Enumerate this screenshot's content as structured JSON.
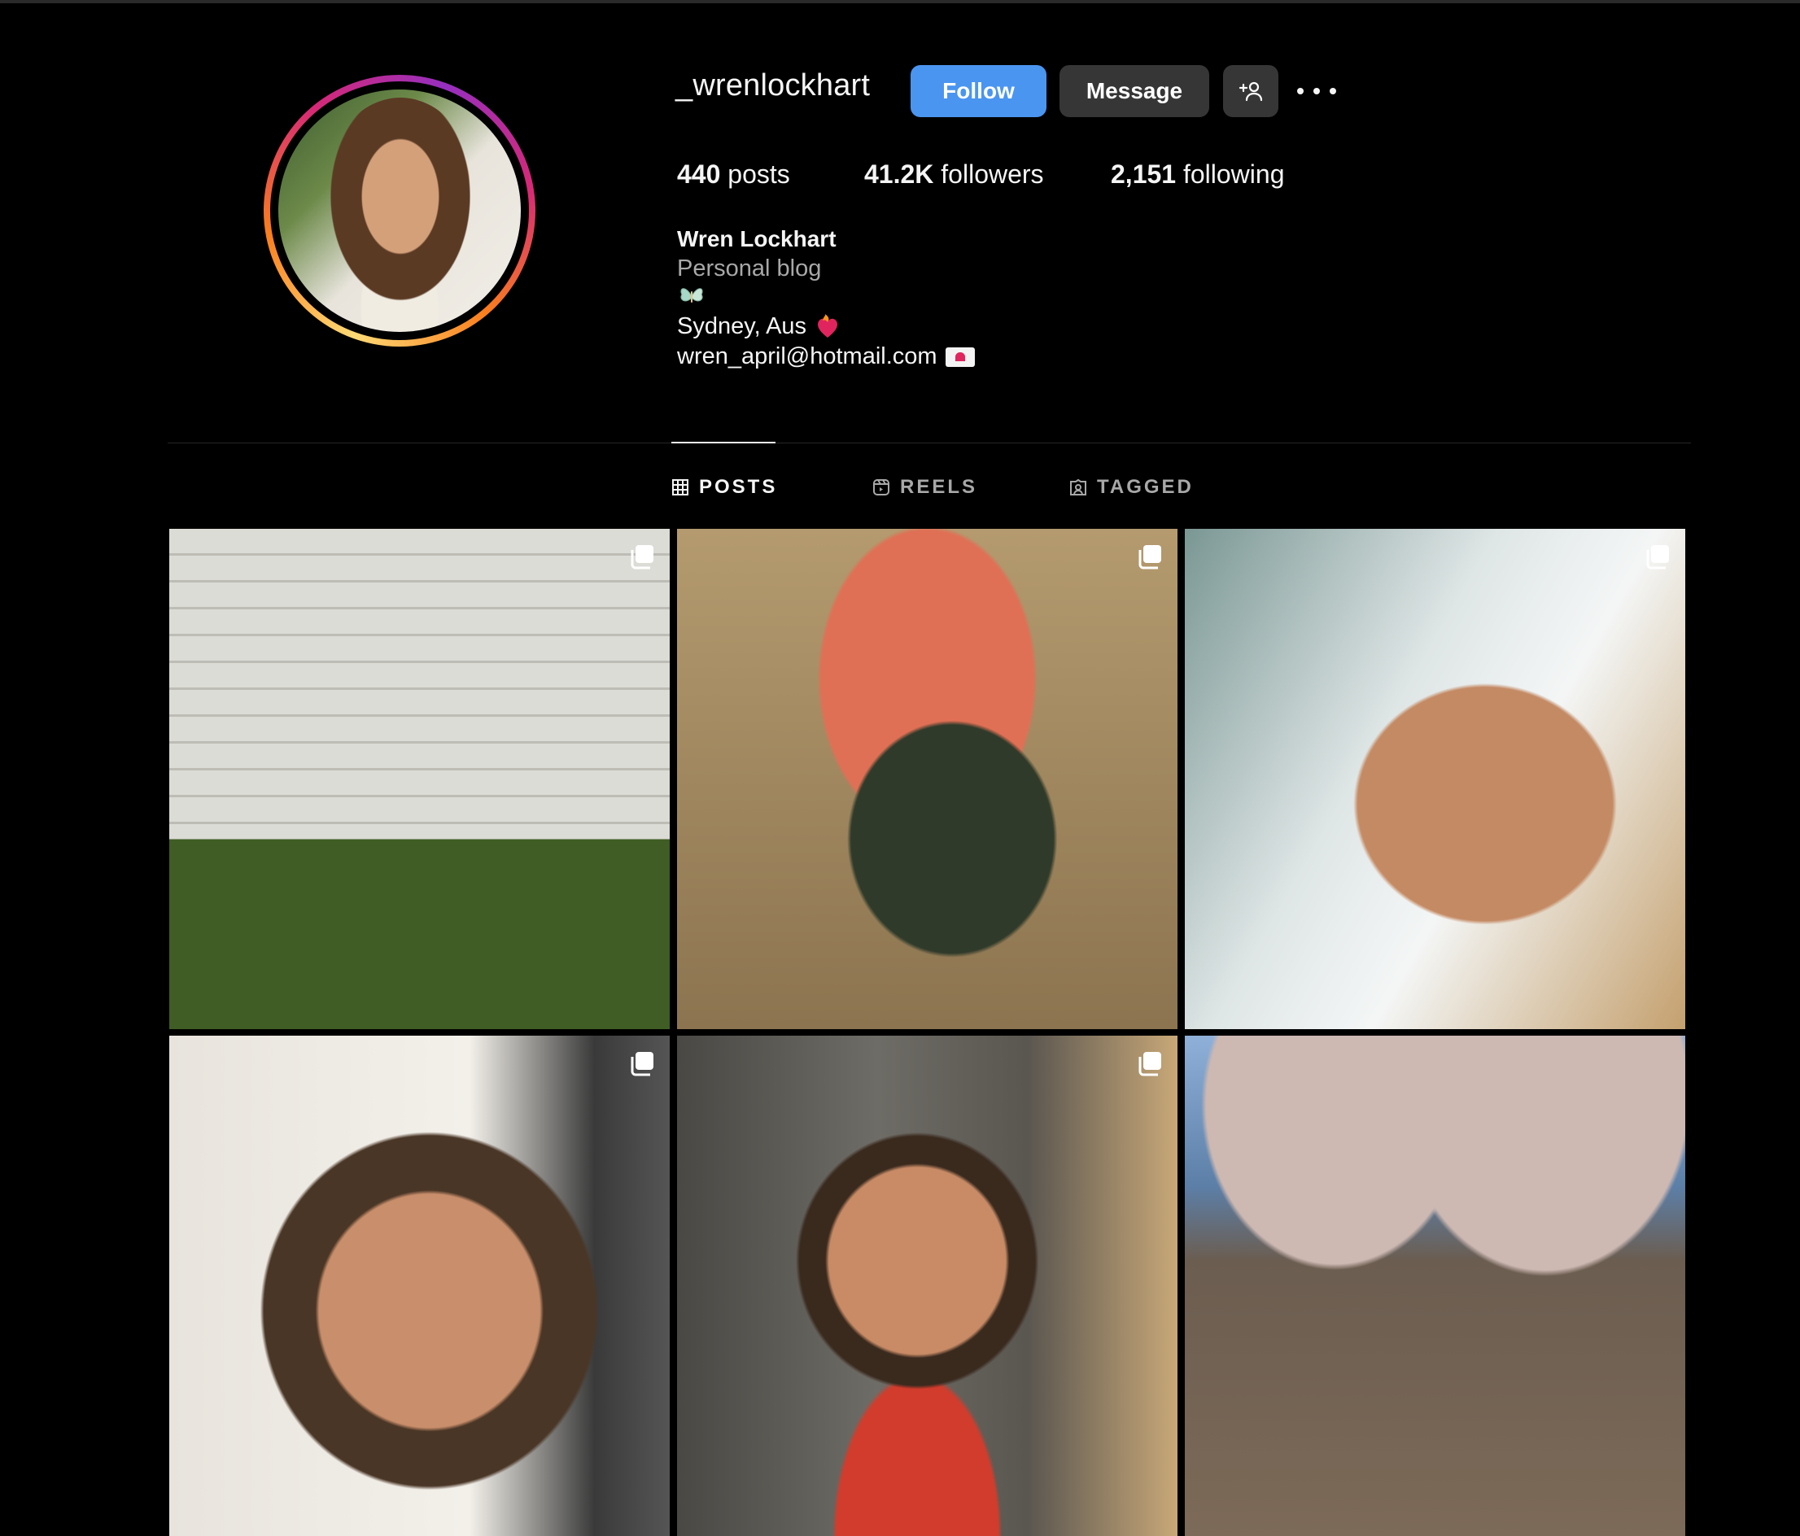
{
  "profile": {
    "username": "_wrenlockhart",
    "follow_label": "Follow",
    "message_label": "Message",
    "stats": {
      "posts_count": "440",
      "posts_label": " posts",
      "followers_count": "41.2K",
      "followers_label": " followers",
      "following_count": "2,151",
      "following_label": " following"
    },
    "bio": {
      "name": "Wren Lockhart",
      "category": "Personal blog",
      "location": "Sydney, Aus",
      "email": "wren_april@hotmail.com"
    }
  },
  "tabs": [
    {
      "label": "POSTS",
      "icon": "grid-icon",
      "active": true
    },
    {
      "label": "REELS",
      "icon": "reels-icon",
      "active": false
    },
    {
      "label": "TAGGED",
      "icon": "tagged-icon",
      "active": false
    }
  ],
  "posts": [
    {
      "multiple": true
    },
    {
      "multiple": true
    },
    {
      "multiple": true
    },
    {
      "multiple": true
    },
    {
      "multiple": true
    },
    {
      "multiple": false
    }
  ],
  "colors": {
    "accent": "#4a95f0",
    "secondary_button": "#363636",
    "background": "#000000",
    "muted_text": "#a8a8a8"
  }
}
